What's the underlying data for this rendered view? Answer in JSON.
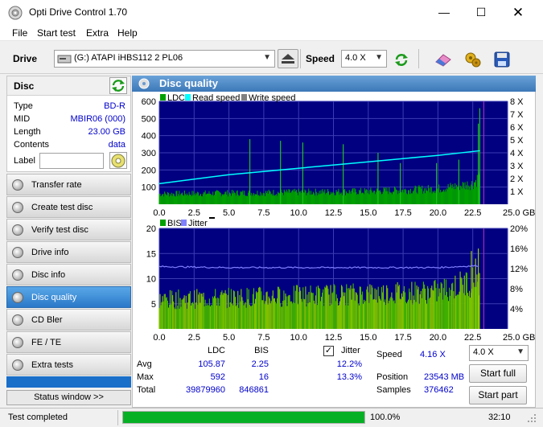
{
  "window": {
    "title": "Opti Drive Control 1.70"
  },
  "menu": [
    "File",
    "Start test",
    "Extra",
    "Help"
  ],
  "drivebar": {
    "drive_label": "Drive",
    "drive_value": "(G:)  ATAPI iHBS112  2 PL06",
    "speed_label": "Speed",
    "speed_value": "4.0 X"
  },
  "disc": {
    "header": "Disc",
    "rows": [
      {
        "k": "Type",
        "v": "BD-R"
      },
      {
        "k": "MID",
        "v": "MBIR06 (000)"
      },
      {
        "k": "Length",
        "v": "23.00 GB"
      },
      {
        "k": "Contents",
        "v": "data"
      }
    ],
    "label_label": "Label",
    "label_value": ""
  },
  "nav": [
    {
      "label": "Transfer rate",
      "active": false
    },
    {
      "label": "Create test disc",
      "active": false
    },
    {
      "label": "Verify test disc",
      "active": false
    },
    {
      "label": "Drive info",
      "active": false
    },
    {
      "label": "Disc info",
      "active": false
    },
    {
      "label": "Disc quality",
      "active": true
    },
    {
      "label": "CD Bler",
      "active": false
    },
    {
      "label": "FE / TE",
      "active": false
    },
    {
      "label": "Extra tests",
      "active": false
    }
  ],
  "status_window_label": "Status window >>",
  "panel_title": "Disc quality",
  "colors": {
    "ldc": "#00a000",
    "read": "#00ffff",
    "write": "#808080",
    "bis": "#00a000",
    "jitter": "#8080ff",
    "plot_bg": "#000080",
    "grid": "#3c3cb4",
    "accent": "#1a6fc9"
  },
  "chart_data": [
    {
      "type": "bar",
      "legend": [
        "LDC",
        "Read speed",
        "Write speed"
      ],
      "x_ticks": [
        "0.0",
        "2.5",
        "5.0",
        "7.5",
        "10.0",
        "12.5",
        "15.0",
        "17.5",
        "20.0",
        "22.5",
        "25.0 GB"
      ],
      "y_ticks_left": [
        "600",
        "500",
        "400",
        "300",
        "200",
        "100"
      ],
      "y_ticks_right": [
        "8 X",
        "7 X",
        "6 X",
        "5 X",
        "4 X",
        "3 X",
        "2 X",
        "1 X"
      ],
      "xlim": [
        0,
        25
      ],
      "ylim": [
        0,
        600
      ],
      "y2lim": [
        0,
        8
      ],
      "ldc_baseline": [
        [
          0,
          60
        ],
        [
          5,
          65
        ],
        [
          10,
          70
        ],
        [
          15,
          75
        ],
        [
          20,
          90
        ],
        [
          22.5,
          120
        ],
        [
          23.0,
          160
        ]
      ],
      "ldc_spikes": [
        [
          6.5,
          380
        ],
        [
          8.7,
          370
        ],
        [
          10.3,
          360
        ],
        [
          13.2,
          350
        ],
        [
          15.7,
          300
        ],
        [
          17.3,
          240
        ],
        [
          19.9,
          240
        ],
        [
          21.5,
          260
        ],
        [
          22.9,
          470
        ],
        [
          23.0,
          560
        ]
      ],
      "read_speed": [
        [
          0,
          1.6
        ],
        [
          5,
          2.3
        ],
        [
          10,
          2.8
        ],
        [
          15,
          3.3
        ],
        [
          20,
          3.8
        ],
        [
          23.0,
          4.16
        ]
      ],
      "data_end": 23.0
    },
    {
      "type": "bar",
      "legend": [
        "BIS",
        "Jitter"
      ],
      "x_ticks": [
        "0.0",
        "2.5",
        "5.0",
        "7.5",
        "10.0",
        "12.5",
        "15.0",
        "17.5",
        "20.0",
        "22.5",
        "25.0 GB"
      ],
      "y_ticks_left": [
        "20",
        "15",
        "10",
        "5"
      ],
      "y_ticks_right": [
        "20%",
        "16%",
        "12%",
        "8%",
        "4%"
      ],
      "xlim": [
        0,
        25
      ],
      "ylim": [
        0,
        20
      ],
      "y2lim": [
        0,
        20
      ],
      "bis_range": [
        [
          0,
          7
        ],
        [
          20,
          9
        ],
        [
          23.0,
          12
        ]
      ],
      "jitter": [
        [
          0,
          12.4
        ],
        [
          5,
          12.2
        ],
        [
          10,
          12.2
        ],
        [
          15,
          12.2
        ],
        [
          20,
          12.2
        ],
        [
          23.0,
          12.6
        ]
      ],
      "data_end": 23.0
    }
  ],
  "stats": {
    "cols": [
      "LDC",
      "BIS"
    ],
    "jitter_label": "Jitter",
    "jitter_checked": true,
    "rows": [
      {
        "label": "Avg",
        "ldc": "105.87",
        "bis": "2.25",
        "jitter": "12.2%"
      },
      {
        "label": "Max",
        "ldc": "592",
        "bis": "16",
        "jitter": "13.3%"
      },
      {
        "label": "Total",
        "ldc": "39879960",
        "bis": "846861",
        "jitter": ""
      }
    ],
    "speed_label": "Speed",
    "speed_value": "4.16 X",
    "position_label": "Position",
    "position_value": "23543 MB",
    "samples_label": "Samples",
    "samples_value": "376462",
    "speed_select": "4.0 X",
    "start_full": "Start full",
    "start_part": "Start part"
  },
  "statusbar": {
    "text": "Test completed",
    "progress": 1.0,
    "percent": "100.0%",
    "time": "32:10"
  }
}
